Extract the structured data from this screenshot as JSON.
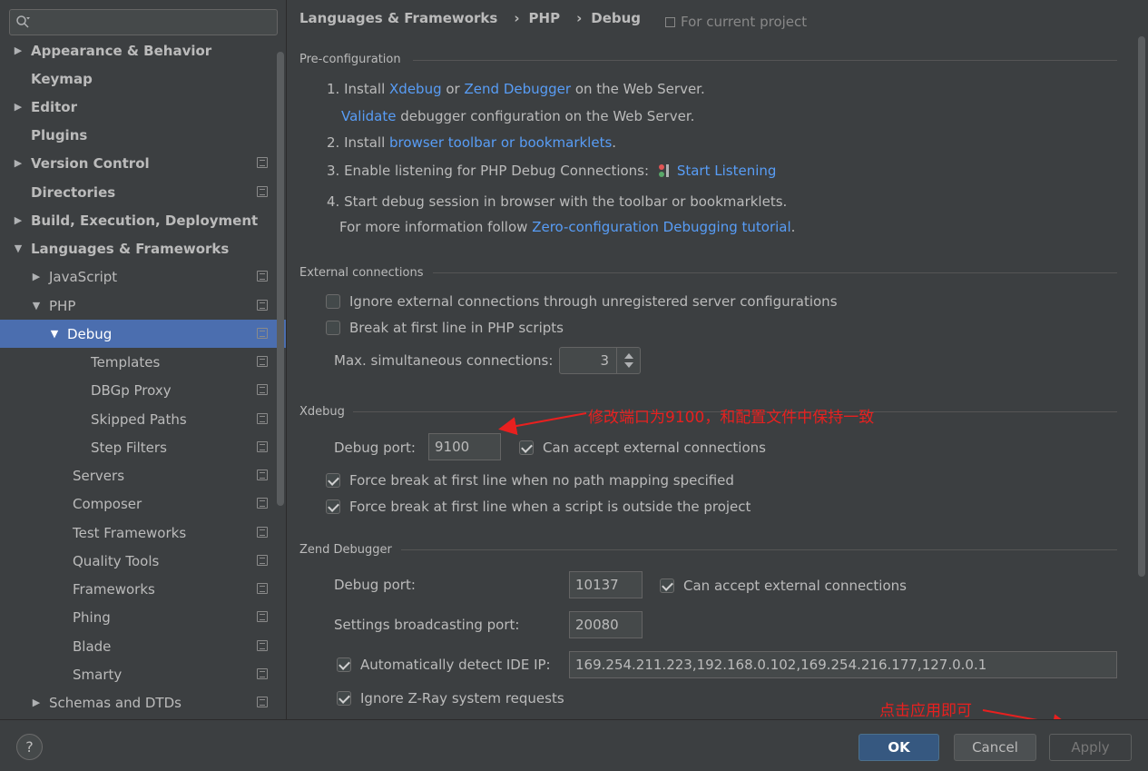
{
  "sidebar": {
    "items": [
      {
        "label": "Appearance & Behavior",
        "expander": "▶"
      },
      {
        "label": "Keymap",
        "expander": ""
      },
      {
        "label": "Editor",
        "expander": "▶"
      },
      {
        "label": "Plugins",
        "expander": ""
      },
      {
        "label": "Version Control",
        "expander": "▶"
      },
      {
        "label": "Directories",
        "expander": ""
      },
      {
        "label": "Build, Execution, Deployment",
        "expander": "▶"
      },
      {
        "label": "Languages & Frameworks",
        "expander": "▼"
      },
      {
        "label": "JavaScript",
        "expander": "▶"
      },
      {
        "label": "PHP",
        "expander": "▼"
      },
      {
        "label": "Debug",
        "expander": "▼"
      },
      {
        "label": "Templates",
        "expander": ""
      },
      {
        "label": "DBGp Proxy",
        "expander": ""
      },
      {
        "label": "Skipped Paths",
        "expander": ""
      },
      {
        "label": "Step Filters",
        "expander": ""
      },
      {
        "label": "Servers",
        "expander": ""
      },
      {
        "label": "Composer",
        "expander": ""
      },
      {
        "label": "Test Frameworks",
        "expander": ""
      },
      {
        "label": "Quality Tools",
        "expander": ""
      },
      {
        "label": "Frameworks",
        "expander": ""
      },
      {
        "label": "Phing",
        "expander": ""
      },
      {
        "label": "Blade",
        "expander": ""
      },
      {
        "label": "Smarty",
        "expander": ""
      },
      {
        "label": "Schemas and DTDs",
        "expander": "▶"
      }
    ]
  },
  "breadcrumb": {
    "items": [
      "Languages & Frameworks",
      "PHP",
      "Debug"
    ],
    "separator": "›"
  },
  "project_note": "For current project",
  "preconfig": {
    "title": "Pre-configuration",
    "step1_prefix": "1. Install",
    "xdebug_link": "Xdebug",
    "or": "or",
    "zend_link": "Zend Debugger",
    "step1_suffix": "on the Web Server.",
    "validate_link": "Validate",
    "validate_suffix": "debugger configuration on the Web Server.",
    "step2_prefix": "2. Install",
    "toolbar_link": "browser toolbar or bookmarklets",
    "step2_suffix": ".",
    "step3_prefix": "3. Enable listening for PHP Debug Connections:",
    "start_link": "Start Listening",
    "step4": "4. Start debug session in browser with the toolbar or bookmarklets.",
    "more_prefix": "For more information follow",
    "tutorial_link": "Zero-configuration Debugging tutorial",
    "more_suffix": "."
  },
  "external": {
    "title": "External connections",
    "ignore_label": "Ignore external connections through unregistered server configurations",
    "ignore_checked": false,
    "break_label": "Break at first line in PHP scripts",
    "break_checked": false,
    "max_label": "Max. simultaneous connections:",
    "max_value": "3"
  },
  "xdebug": {
    "title": "Xdebug",
    "port_label": "Debug port:",
    "port_value": "9100",
    "accept_label": "Can accept external connections",
    "accept_checked": true,
    "force_no_mapping_label": "Force break at first line when no path mapping specified",
    "force_no_mapping_checked": true,
    "force_outside_label": "Force break at first line when a script is outside the project",
    "force_outside_checked": true
  },
  "zend": {
    "title": "Zend Debugger",
    "port_label": "Debug port:",
    "port_value": "10137",
    "accept_label": "Can accept external connections",
    "accept_checked": true,
    "broadcast_label": "Settings broadcasting port:",
    "broadcast_value": "20080",
    "detect_label": "Automatically detect IDE IP:",
    "detect_checked": true,
    "detect_value": "169.254.211.223,192.168.0.102,169.254.216.177,127.0.0.1",
    "zray_label": "Ignore Z-Ray system requests",
    "zray_checked": true
  },
  "annotations": {
    "port_note": "修改端口为9100，和配置文件中保持一致",
    "apply_note": "点击应用即可",
    "color": "#e8201f"
  },
  "footer": {
    "help": "?",
    "ok": "OK",
    "cancel": "Cancel",
    "apply": "Apply"
  },
  "colors": {
    "background": "#3c3f41",
    "selection": "#4b6eaf",
    "link": "#589df6",
    "primary_button": "#365880"
  }
}
